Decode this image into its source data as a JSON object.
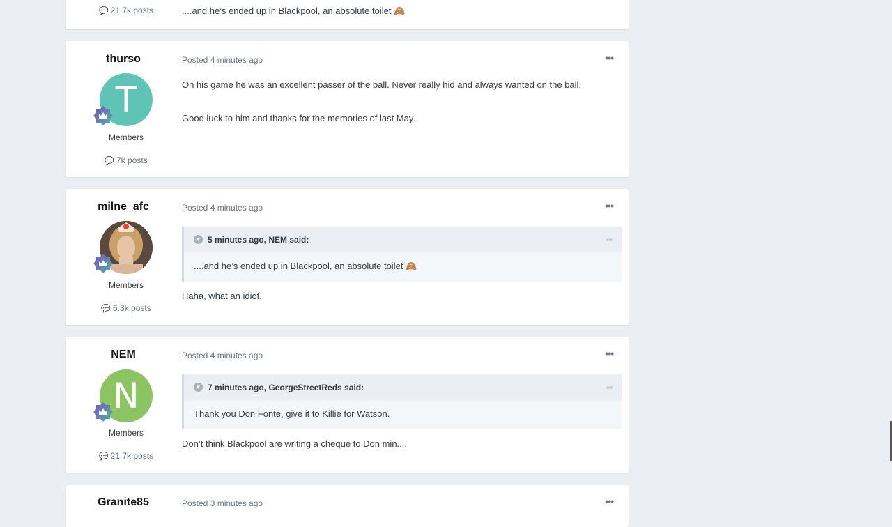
{
  "top_post": {
    "posts_count": "21.7k posts",
    "text": "....and he’s ended up in Blackpool, an absolute toilet 🙈"
  },
  "posts": [
    {
      "author": "thurso",
      "avatar_letter": "T",
      "avatar_color": "#5fc4b6",
      "group": "Members",
      "posts_count": "7k posts",
      "posted": "Posted 4 minutes ago",
      "paragraphs": [
        "On his game he was an excellent passer of the ball. Never really hid and always wanted on the ball.",
        "Good luck to him and thanks for the memories of last May."
      ]
    },
    {
      "author": "milne_afc",
      "group": "Members",
      "posts_count": "6.3k posts",
      "posted": "Posted 4 minutes ago",
      "quote_header": "5 minutes ago, NEM said:",
      "quote_text": "....and he’s ended up in Blackpool, an absolute toilet 🙈",
      "reply": "Haha, what an idiot."
    },
    {
      "author": "NEM",
      "avatar_letter": "N",
      "avatar_color": "#8dc463",
      "group": "Members",
      "posts_count": "21.7k posts",
      "posted": "Posted 4 minutes ago",
      "quote_header": "7 minutes ago, GeorgeStreetReds said:",
      "quote_text": "Thank you Don Fonte, give it to Killie for Watson.",
      "reply": "Don’t think Blackpool are writing a cheque to Don min...."
    }
  ],
  "bottom_post": {
    "author": "Granite85",
    "posted": "Posted 3 minutes ago"
  },
  "icons": {
    "more": "more-options-icon",
    "comment": "comment-bubble-icon",
    "badge": "crown-badge-icon",
    "collapse": "chevron-down-icon",
    "share": "share-arrow-icon"
  }
}
